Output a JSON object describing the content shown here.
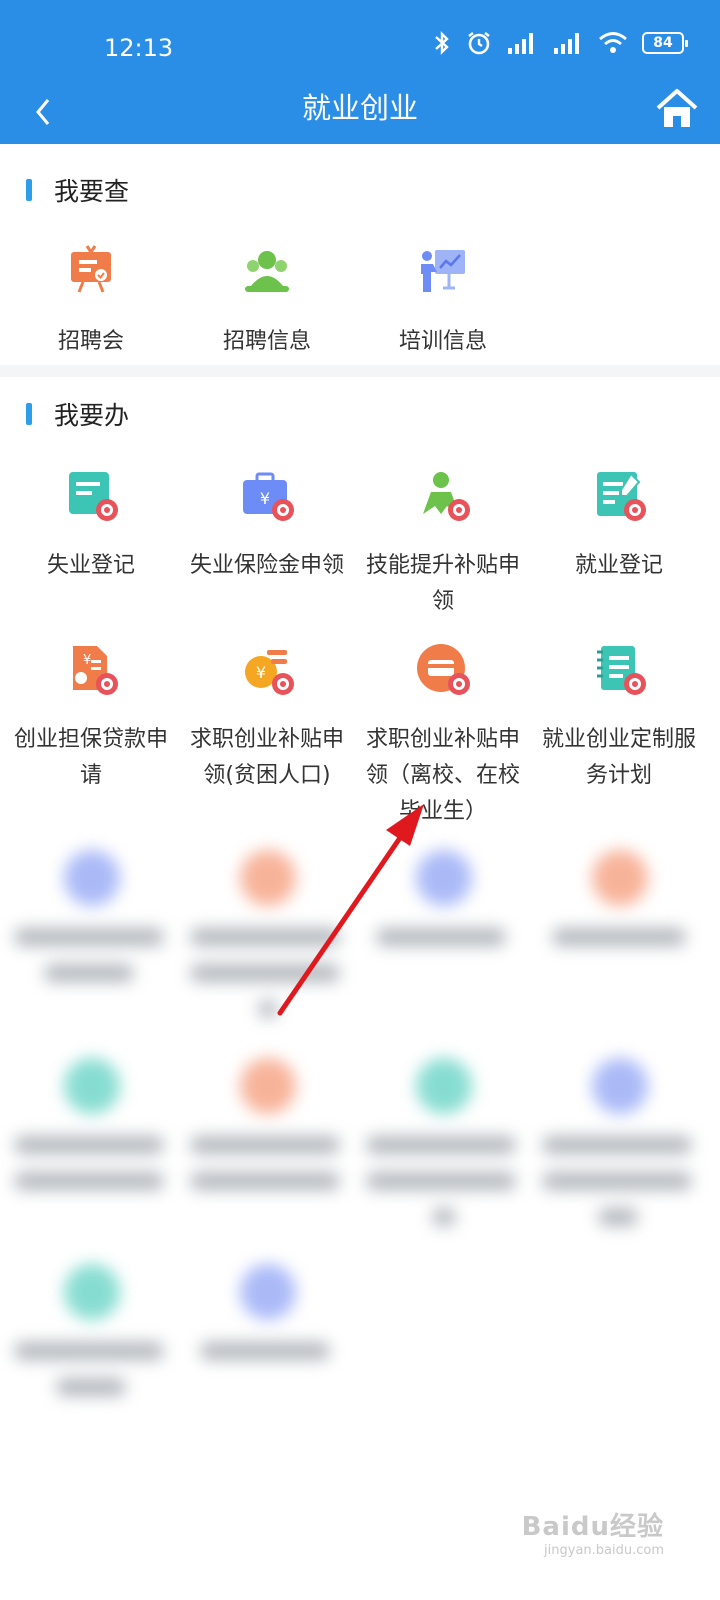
{
  "status_bar": {
    "time": "12:13",
    "battery": "84"
  },
  "nav": {
    "title": "就业创业"
  },
  "colors": {
    "primary": "#2b8ee6",
    "accent_bar": "#2b9fe8",
    "orange": "#f07c4a",
    "green": "#6cc24a",
    "blue": "#6e8cf5",
    "teal": "#3cc5b5"
  },
  "sections": [
    {
      "title": "我要查",
      "items": [
        {
          "label": "招聘会",
          "icon": "job-fair-icon"
        },
        {
          "label": "招聘信息",
          "icon": "recruitment-info-icon"
        },
        {
          "label": "培训信息",
          "icon": "training-info-icon"
        }
      ]
    },
    {
      "title": "我要办",
      "items": [
        {
          "label": "失业登记",
          "icon": "unemployment-registration-icon"
        },
        {
          "label": "失业保险金申领",
          "icon": "unemployment-insurance-icon"
        },
        {
          "label": "技能提升补贴申领",
          "icon": "skill-subsidy-icon"
        },
        {
          "label": "就业登记",
          "icon": "employment-registration-icon"
        },
        {
          "label": "创业担保贷款申请",
          "icon": "startup-loan-icon"
        },
        {
          "label": "求职创业补贴申领(贫困人口)",
          "icon": "job-subsidy-poverty-icon"
        },
        {
          "label": "求职创业补贴申领（离校、在校毕业生）",
          "icon": "job-subsidy-graduate-icon"
        },
        {
          "label": "就业创业定制服务计划",
          "icon": "custom-service-plan-icon"
        }
      ]
    }
  ],
  "watermark": {
    "main": "Baidu经验",
    "sub": "jingyan.baidu.com"
  }
}
